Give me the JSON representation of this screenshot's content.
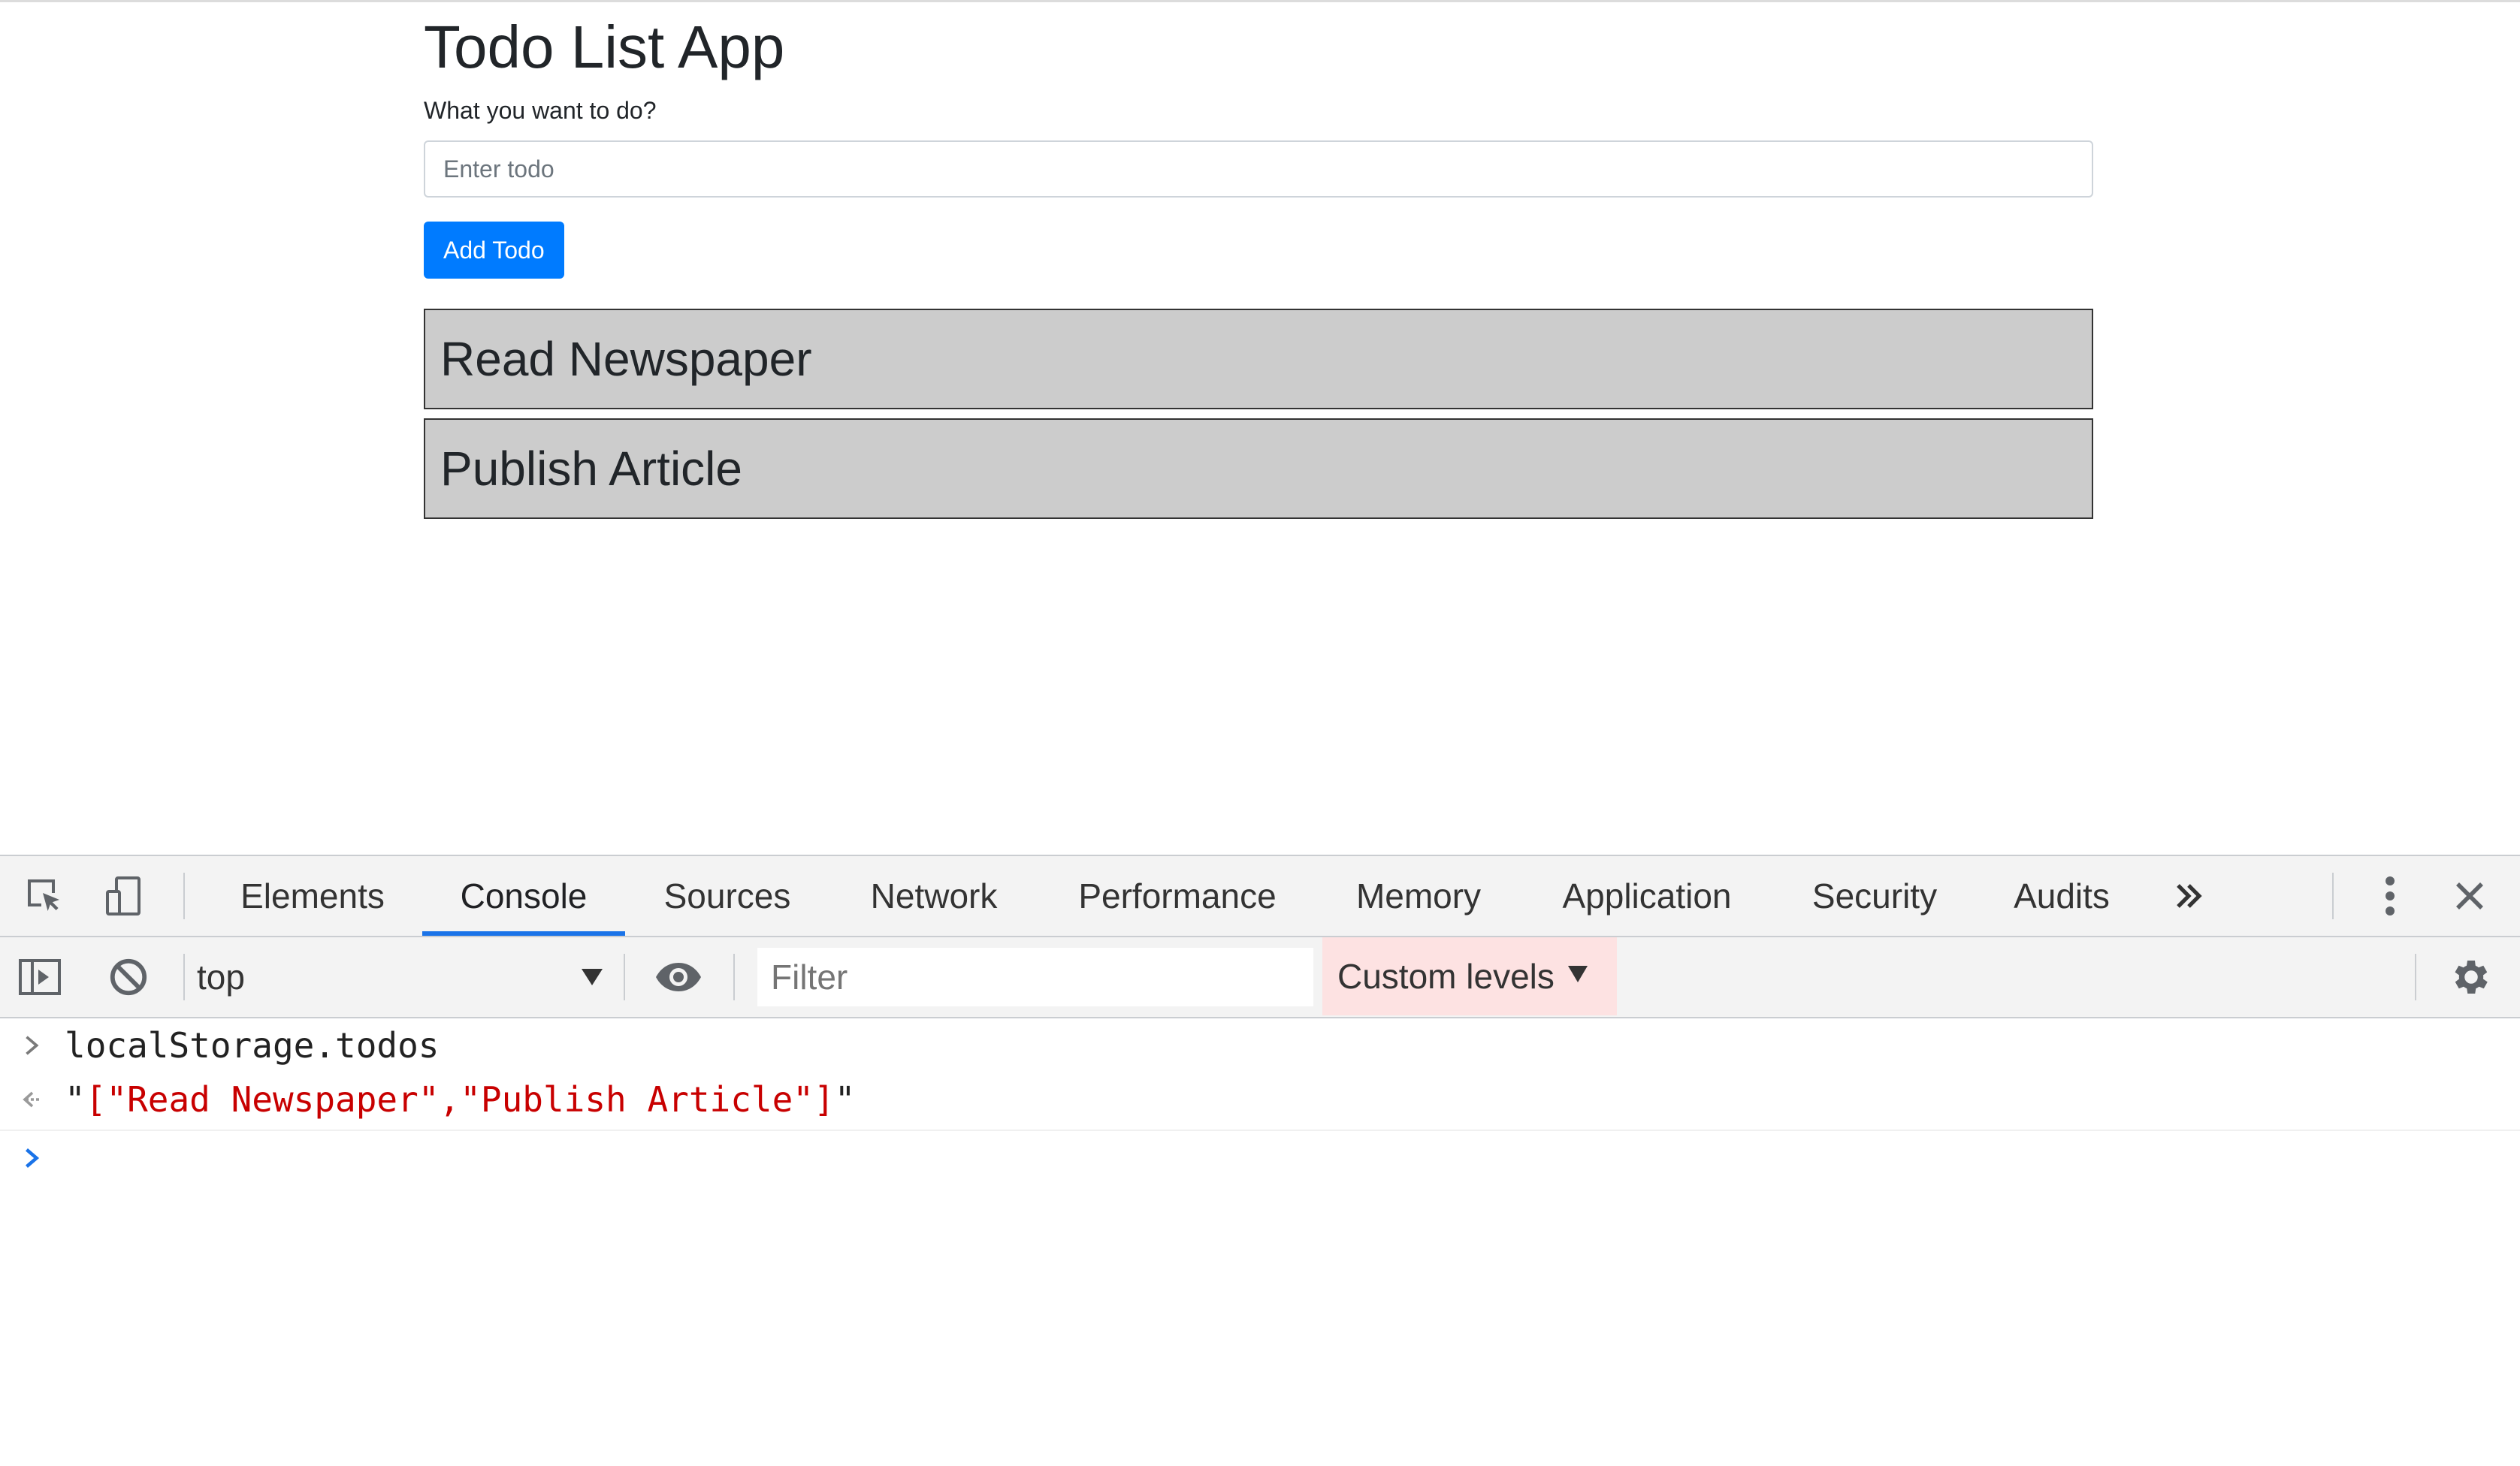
{
  "page": {
    "title": "Todo List App",
    "prompt_label": "What you want to do?",
    "input_placeholder": "Enter todo",
    "input_value": "",
    "add_button_label": "Add Todo",
    "todos": [
      "Read Newspaper",
      "Publish Article"
    ]
  },
  "devtools": {
    "icons": {
      "inspect": "inspect-element-icon",
      "device": "device-toolbar-icon",
      "more_tabs": "chevron-double-right-icon",
      "menu": "kebab-menu-icon",
      "close": "close-icon",
      "sidebar": "console-sidebar-icon",
      "clear": "clear-console-icon",
      "eye": "live-expression-eye-icon",
      "settings": "gear-icon"
    },
    "tabs": [
      {
        "label": "Elements",
        "active": false
      },
      {
        "label": "Console",
        "active": true
      },
      {
        "label": "Sources",
        "active": false
      },
      {
        "label": "Network",
        "active": false
      },
      {
        "label": "Performance",
        "active": false
      },
      {
        "label": "Memory",
        "active": false
      },
      {
        "label": "Application",
        "active": false
      },
      {
        "label": "Security",
        "active": false
      },
      {
        "label": "Audits",
        "active": false
      }
    ],
    "toolbar": {
      "context": "top",
      "filter_placeholder": "Filter",
      "filter_value": "",
      "levels_label": "Custom levels"
    },
    "console": {
      "input_command": "localStorage.todos",
      "output_quote": "\"",
      "output_value": "[\"Read Newspaper\",\"Publish Article\"]"
    }
  },
  "colors": {
    "primary_button": "#007bff",
    "todo_item_bg": "#cccccc",
    "todo_item_border": "#333333",
    "active_tab_underline": "#1a73e8",
    "console_string": "#c80000",
    "levels_bg": "#fde2e2",
    "prompt_arrow": "#1a73e8"
  }
}
